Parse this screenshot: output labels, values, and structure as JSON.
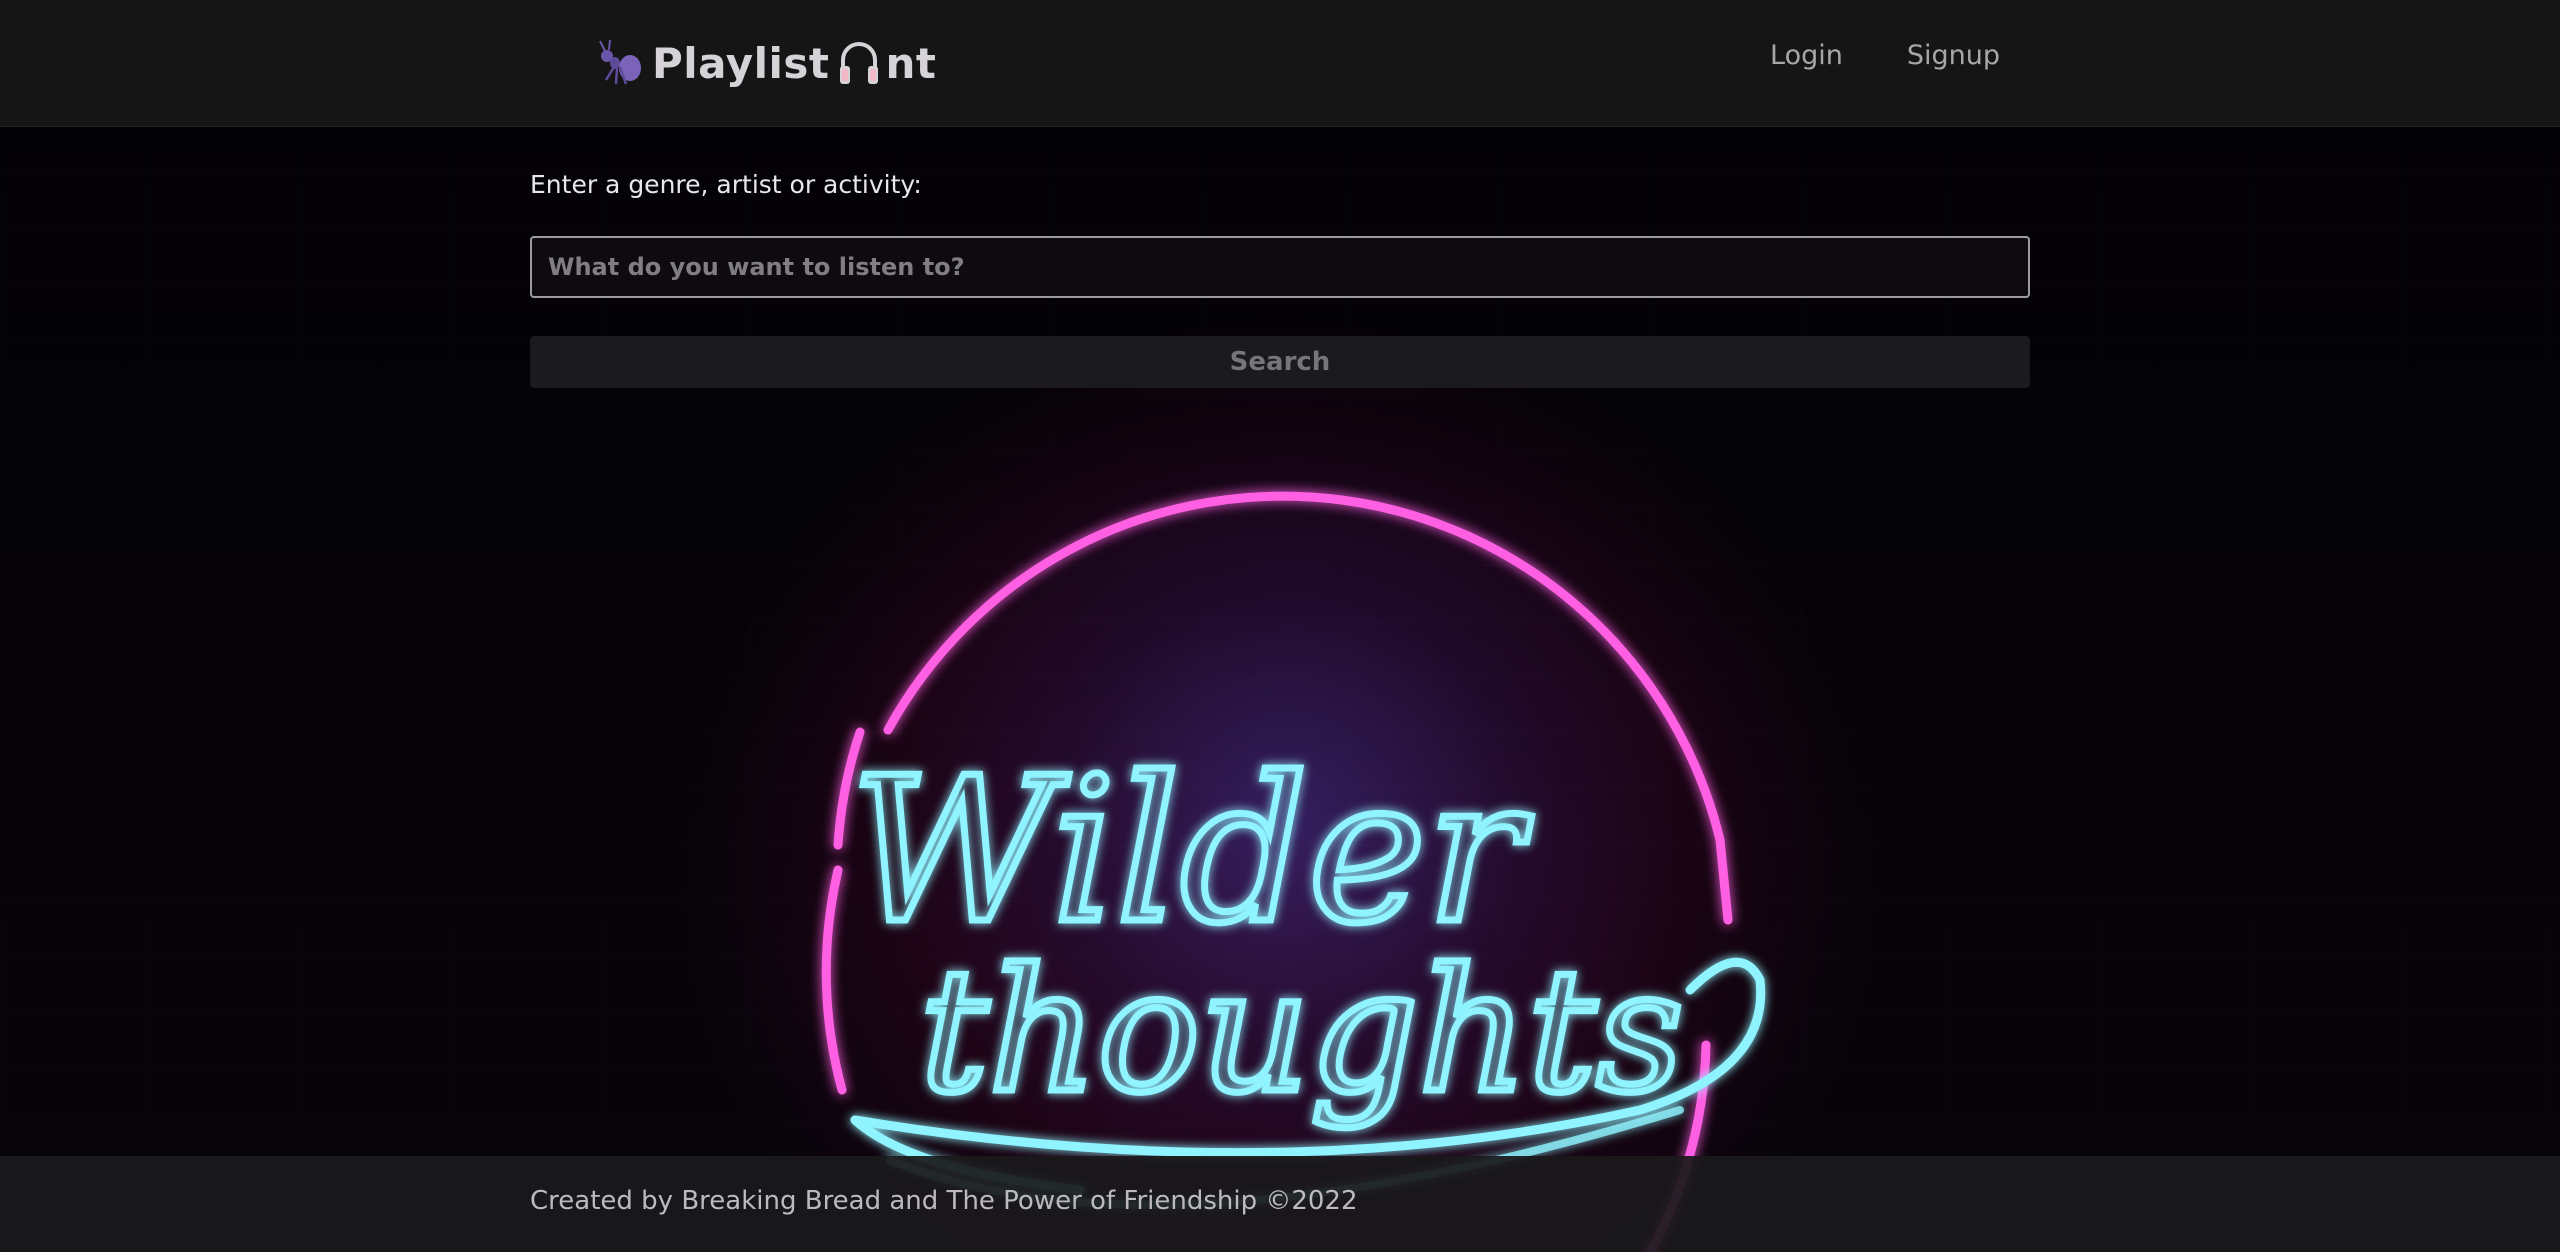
{
  "app": {
    "brand_word_1": "Playlist",
    "brand_word_2": "nt",
    "accent_color": "#7a63b8"
  },
  "nav": {
    "login_label": "Login",
    "signup_label": "Signup"
  },
  "search": {
    "label": "Enter a genre, artist or activity:",
    "placeholder": "What do you want to listen to?",
    "value": "",
    "button_label": "Search"
  },
  "hero": {
    "sign_line_1": "Wilder",
    "sign_line_2": "thoughts",
    "circle_color": "#ff5fe3",
    "text_color": "#8ff4ff"
  },
  "footer": {
    "text": "Created by Breaking Bread and The Power of Friendship ©2022"
  },
  "icons": [
    "ant-icon",
    "headphones-icon"
  ]
}
